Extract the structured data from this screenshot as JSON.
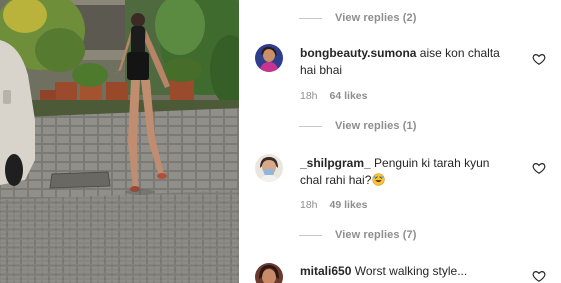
{
  "replies_links": [
    {
      "label": "View replies (2)"
    },
    {
      "label": "View replies (1)"
    },
    {
      "label": "View replies (7)"
    }
  ],
  "comments": [
    {
      "username": "bongbeauty.sumona",
      "text": "aise kon chalta hai bhai",
      "time": "18h",
      "likes": "64 likes",
      "icon": "heart-outline-icon"
    },
    {
      "username": "_shilpgram_",
      "text": "Penguin ki tarah kyun chal rahi hai?",
      "emoji": "rolling-on-floor-laughing-emoji",
      "time": "18h",
      "likes": "49 likes",
      "icon": "heart-outline-icon"
    },
    {
      "username": "mitali650",
      "text": "Worst walking style...",
      "icon": "heart-outline-icon"
    }
  ],
  "colors": {
    "username": "#262626",
    "secondary_text": "#8e8e8e",
    "divider_line": "#c7c7c7"
  }
}
